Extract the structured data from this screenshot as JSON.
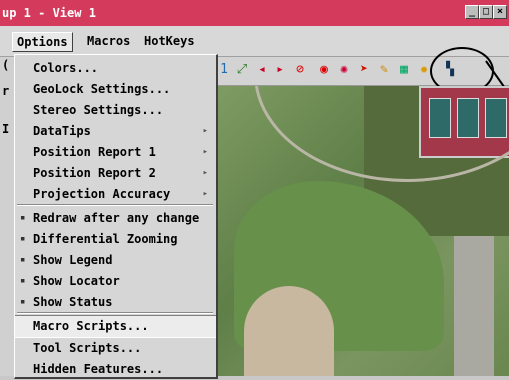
{
  "window": {
    "title": "up 1 - View 1",
    "controls": [
      "minimize",
      "maximize",
      "close"
    ]
  },
  "menubar": {
    "items": [
      "Options",
      "Macros",
      "HotKeys"
    ]
  },
  "dropdown": {
    "items": [
      {
        "label": "Colors...",
        "submenu": false,
        "check": ""
      },
      {
        "label": "GeoLock Settings...",
        "submenu": false,
        "check": ""
      },
      {
        "label": "Stereo Settings...",
        "submenu": false,
        "check": ""
      },
      {
        "label": "DataTips",
        "submenu": true,
        "check": ""
      },
      {
        "label": "Position Report 1",
        "submenu": true,
        "check": ""
      },
      {
        "label": "Position Report 2",
        "submenu": true,
        "check": ""
      },
      {
        "label": "Projection Accuracy",
        "submenu": true,
        "check": ""
      },
      {
        "label": "Redraw after any change",
        "submenu": false,
        "check": "toggle"
      },
      {
        "label": "Differential Zooming",
        "submenu": false,
        "check": "toggle"
      },
      {
        "label": "Show Legend",
        "submenu": false,
        "check": "toggle"
      },
      {
        "label": "Show Locator",
        "submenu": false,
        "check": "toggle"
      },
      {
        "label": "Show Status",
        "submenu": false,
        "check": "toggle"
      },
      {
        "label": "Macro Scripts...",
        "submenu": false,
        "check": ""
      },
      {
        "label": "Tool Scripts...",
        "submenu": false,
        "check": ""
      },
      {
        "label": "Hidden Features...",
        "submenu": false,
        "check": ""
      }
    ],
    "selected": "Macro Scripts..."
  },
  "left_fragments": [
    "(",
    "r",
    "I"
  ],
  "toolbar_icons": [
    "zoom-level-1-icon",
    "measure-icon",
    "arrows-icon",
    "arrows-right-icon",
    "no-icon",
    "zoom-icon",
    "target-icon",
    "pointer-icon",
    "draw-icon",
    "layers-icon",
    "spot-icon",
    "map-icon"
  ],
  "glyphs": {
    "submenu_arrow": "▸",
    "toggle_mark": "▪"
  }
}
